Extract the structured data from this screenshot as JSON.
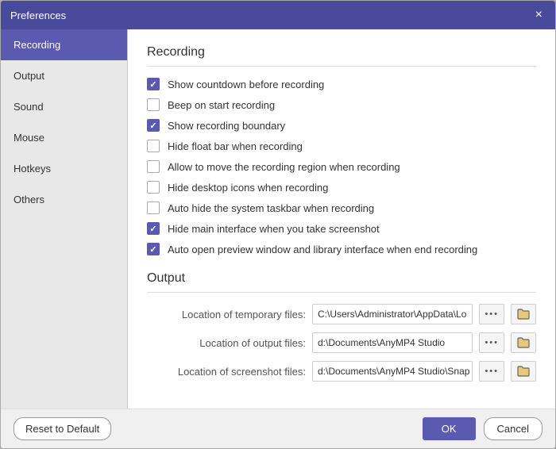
{
  "titleBar": {
    "title": "Preferences",
    "closeLabel": "×"
  },
  "sidebar": {
    "items": [
      {
        "id": "recording",
        "label": "Recording",
        "active": true
      },
      {
        "id": "output",
        "label": "Output",
        "active": false
      },
      {
        "id": "sound",
        "label": "Sound",
        "active": false
      },
      {
        "id": "mouse",
        "label": "Mouse",
        "active": false
      },
      {
        "id": "hotkeys",
        "label": "Hotkeys",
        "active": false
      },
      {
        "id": "others",
        "label": "Others",
        "active": false
      }
    ]
  },
  "recording": {
    "sectionTitle": "Recording",
    "checkboxes": [
      {
        "id": "countdown",
        "label": "Show countdown before recording",
        "checked": true
      },
      {
        "id": "beep",
        "label": "Beep on start recording",
        "checked": false
      },
      {
        "id": "boundary",
        "label": "Show recording boundary",
        "checked": true
      },
      {
        "id": "floatbar",
        "label": "Hide float bar when recording",
        "checked": false
      },
      {
        "id": "moveregion",
        "label": "Allow to move the recording region when recording",
        "checked": false
      },
      {
        "id": "hideicons",
        "label": "Hide desktop icons when recording",
        "checked": false
      },
      {
        "id": "taskbar",
        "label": "Auto hide the system taskbar when recording",
        "checked": false
      },
      {
        "id": "maininterface",
        "label": "Hide main interface when you take screenshot",
        "checked": true
      },
      {
        "id": "autoopen",
        "label": "Auto open preview window and library interface when end recording",
        "checked": true
      }
    ]
  },
  "output": {
    "sectionTitle": "Output",
    "rows": [
      {
        "id": "temp",
        "label": "Location of temporary files:",
        "value": "C:\\Users\\Administrator\\AppData\\Lo",
        "dots": "•••"
      },
      {
        "id": "outputfiles",
        "label": "Location of output files:",
        "value": "d:\\Documents\\AnyMP4 Studio",
        "dots": "•••"
      },
      {
        "id": "screenshot",
        "label": "Location of screenshot files:",
        "value": "d:\\Documents\\AnyMP4 Studio\\Snap",
        "dots": "•••"
      }
    ]
  },
  "footer": {
    "resetLabel": "Reset to Default",
    "okLabel": "OK",
    "cancelLabel": "Cancel"
  },
  "icons": {
    "folder": "🗁",
    "folderUnicode": "📁"
  }
}
